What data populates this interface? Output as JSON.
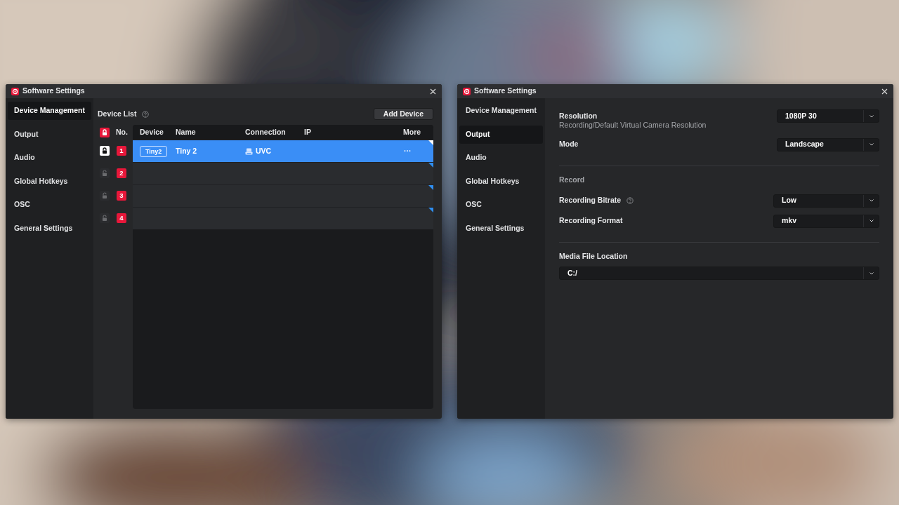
{
  "windows": [
    {
      "title": "Software Settings",
      "kind": "devices",
      "sidebar": {
        "items": [
          {
            "label": "Device Management",
            "selected": true
          },
          {
            "label": "Output",
            "selected": false
          },
          {
            "label": "Audio",
            "selected": false
          },
          {
            "label": "Global Hotkeys",
            "selected": false
          },
          {
            "label": "OSC",
            "selected": false
          },
          {
            "label": "General Settings",
            "selected": false
          }
        ]
      },
      "device_list": {
        "title": "Device List",
        "add_button": "Add Device",
        "header_locked": true,
        "number_heading": "No.",
        "columns": [
          "Device",
          "Name",
          "Connection",
          "IP",
          "More"
        ],
        "rows": [
          {
            "locked": true,
            "number": "1",
            "selected": true,
            "device": "Tiny2",
            "name": "Tiny 2",
            "connection": "UVC",
            "more": "···"
          },
          {
            "locked": false,
            "number": "2",
            "selected": false
          },
          {
            "locked": false,
            "number": "3",
            "selected": false
          },
          {
            "locked": false,
            "number": "4",
            "selected": false
          }
        ]
      }
    },
    {
      "title": "Software Settings",
      "kind": "output",
      "sidebar": {
        "items": [
          {
            "label": "Device Management",
            "selected": false
          },
          {
            "label": "Output",
            "selected": true
          },
          {
            "label": "Audio",
            "selected": false
          },
          {
            "label": "Global Hotkeys",
            "selected": false
          },
          {
            "label": "OSC",
            "selected": false
          },
          {
            "label": "General Settings",
            "selected": false
          }
        ]
      },
      "settings": [
        {
          "kind": "select",
          "label": "Resolution",
          "description": "Recording/Default Virtual Camera Resolution",
          "value": "1080P 30"
        },
        {
          "kind": "select",
          "label": "Mode",
          "value": "Landscape"
        },
        {
          "kind": "divider"
        },
        {
          "kind": "heading",
          "label": "Record"
        },
        {
          "kind": "select",
          "label": "Recording Bitrate",
          "help": true,
          "value": "Low"
        },
        {
          "kind": "select",
          "label": "Recording Format",
          "value": "mkv"
        },
        {
          "kind": "divider"
        },
        {
          "kind": "path",
          "label": "Media File Location",
          "value": "C:/"
        }
      ]
    }
  ]
}
